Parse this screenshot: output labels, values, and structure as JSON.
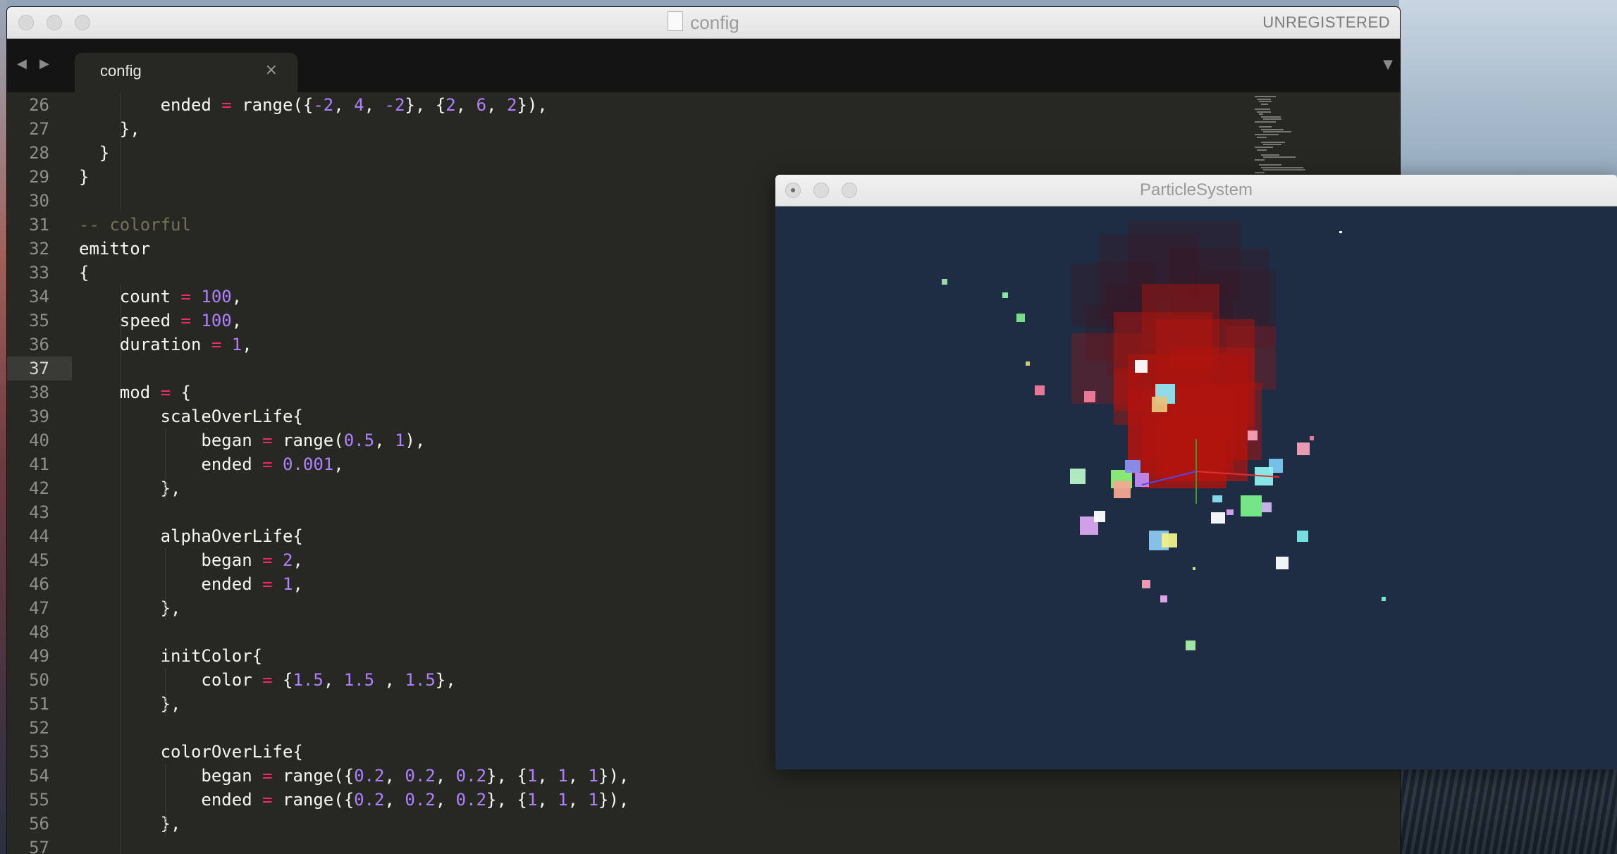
{
  "editor": {
    "window_title": "config",
    "unregistered_label": "UNREGISTERED",
    "tab_label": "config",
    "tab_close": "×",
    "nav_back": "◀",
    "nav_forward": "▶",
    "tab_menu": "▼",
    "current_line": 37,
    "line_numbers": [
      "26",
      "27",
      "28",
      "29",
      "30",
      "31",
      "32",
      "33",
      "34",
      "35",
      "36",
      "37",
      "38",
      "39",
      "40",
      "41",
      "42",
      "43",
      "44",
      "45",
      "46",
      "47",
      "48",
      "49",
      "50",
      "51",
      "52",
      "53",
      "54",
      "55",
      "56",
      "57"
    ],
    "code_lines": [
      [
        [
          "        ended ",
          ""
        ],
        [
          "=",
          "op"
        ],
        [
          " range({",
          ""
        ],
        [
          "-2",
          "num"
        ],
        [
          ", ",
          ""
        ],
        [
          "4",
          "num"
        ],
        [
          ", ",
          ""
        ],
        [
          "-2",
          "num"
        ],
        [
          "}, {",
          ""
        ],
        [
          "2",
          "num"
        ],
        [
          ", ",
          ""
        ],
        [
          "6",
          "num"
        ],
        [
          ", ",
          ""
        ],
        [
          "2",
          "num"
        ],
        [
          "}),",
          ""
        ]
      ],
      [
        [
          "    },",
          ""
        ]
      ],
      [
        [
          "  }",
          ""
        ]
      ],
      [
        [
          "}",
          ""
        ]
      ],
      [
        [
          "",
          ""
        ]
      ],
      [
        [
          "-- colorful",
          "com"
        ]
      ],
      [
        [
          "emittor",
          ""
        ]
      ],
      [
        [
          "{",
          ""
        ]
      ],
      [
        [
          "    count ",
          ""
        ],
        [
          "=",
          "op"
        ],
        [
          " ",
          ""
        ],
        [
          "100",
          "num"
        ],
        [
          ",",
          ""
        ]
      ],
      [
        [
          "    speed ",
          ""
        ],
        [
          "=",
          "op"
        ],
        [
          " ",
          ""
        ],
        [
          "100",
          "num"
        ],
        [
          ",",
          ""
        ]
      ],
      [
        [
          "    duration ",
          ""
        ],
        [
          "=",
          "op"
        ],
        [
          " ",
          ""
        ],
        [
          "1",
          "num"
        ],
        [
          ",",
          ""
        ]
      ],
      [
        [
          "",
          ""
        ]
      ],
      [
        [
          "    mod ",
          ""
        ],
        [
          "=",
          "op"
        ],
        [
          " {",
          ""
        ]
      ],
      [
        [
          "        scaleOverLife{",
          ""
        ]
      ],
      [
        [
          "            began ",
          ""
        ],
        [
          "=",
          "op"
        ],
        [
          " range(",
          ""
        ],
        [
          "0.5",
          "num"
        ],
        [
          ", ",
          ""
        ],
        [
          "1",
          "num"
        ],
        [
          "),",
          ""
        ]
      ],
      [
        [
          "            ended ",
          ""
        ],
        [
          "=",
          "op"
        ],
        [
          " ",
          ""
        ],
        [
          "0.001",
          "num"
        ],
        [
          ",",
          ""
        ]
      ],
      [
        [
          "        },",
          ""
        ]
      ],
      [
        [
          "",
          ""
        ]
      ],
      [
        [
          "        alphaOverLife{",
          ""
        ]
      ],
      [
        [
          "            began ",
          ""
        ],
        [
          "=",
          "op"
        ],
        [
          " ",
          ""
        ],
        [
          "2",
          "num"
        ],
        [
          ",",
          ""
        ]
      ],
      [
        [
          "            ended ",
          ""
        ],
        [
          "=",
          "op"
        ],
        [
          " ",
          ""
        ],
        [
          "1",
          "num"
        ],
        [
          ",",
          ""
        ]
      ],
      [
        [
          "        },",
          ""
        ]
      ],
      [
        [
          "",
          ""
        ]
      ],
      [
        [
          "        initColor{",
          ""
        ]
      ],
      [
        [
          "            color ",
          ""
        ],
        [
          "=",
          "op"
        ],
        [
          " {",
          ""
        ],
        [
          "1.5",
          "num"
        ],
        [
          ", ",
          ""
        ],
        [
          "1.5",
          "num"
        ],
        [
          " , ",
          ""
        ],
        [
          "1.5",
          "num"
        ],
        [
          "},",
          ""
        ]
      ],
      [
        [
          "        },",
          ""
        ]
      ],
      [
        [
          "",
          ""
        ]
      ],
      [
        [
          "        colorOverLife{",
          ""
        ]
      ],
      [
        [
          "            began ",
          ""
        ],
        [
          "=",
          "op"
        ],
        [
          " range({",
          ""
        ],
        [
          "0.2",
          "num"
        ],
        [
          ", ",
          ""
        ],
        [
          "0.2",
          "num"
        ],
        [
          ", ",
          ""
        ],
        [
          "0.2",
          "num"
        ],
        [
          "}, {",
          ""
        ],
        [
          "1",
          "num"
        ],
        [
          ", ",
          ""
        ],
        [
          "1",
          "num"
        ],
        [
          ", ",
          ""
        ],
        [
          "1",
          "num"
        ],
        [
          "}),",
          ""
        ]
      ],
      [
        [
          "            ended ",
          ""
        ],
        [
          "=",
          "op"
        ],
        [
          " range({",
          ""
        ],
        [
          "0.2",
          "num"
        ],
        [
          ", ",
          ""
        ],
        [
          "0.2",
          "num"
        ],
        [
          ", ",
          ""
        ],
        [
          "0.2",
          "num"
        ],
        [
          "}, {",
          ""
        ],
        [
          "1",
          "num"
        ],
        [
          ", ",
          ""
        ],
        [
          "1",
          "num"
        ],
        [
          ", ",
          ""
        ],
        [
          "1",
          "num"
        ],
        [
          "}),",
          ""
        ]
      ],
      [
        [
          "        },",
          ""
        ]
      ],
      [
        [
          "",
          ""
        ]
      ]
    ],
    "colors": {
      "keyword_op": "#f92672",
      "number": "#ae81ff",
      "comment": "#75715e",
      "text": "#f8f8f2",
      "background": "#272822"
    }
  },
  "particle_window": {
    "title": "ParticleSystem",
    "background": "#1f2d44",
    "glow_color": "#b0140e"
  }
}
